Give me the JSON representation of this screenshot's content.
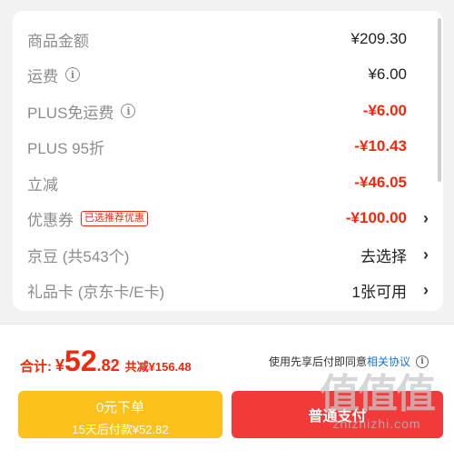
{
  "summary": {
    "rows": [
      {
        "label": "商品金额",
        "value": "¥209.30"
      },
      {
        "label": "运费",
        "value": "¥6.00"
      },
      {
        "label": "PLUS免运费",
        "value": "-¥6.00"
      },
      {
        "label": "PLUS 95折",
        "value": "-¥10.43"
      },
      {
        "label": "立减",
        "value": "-¥46.05"
      },
      {
        "label": "优惠券",
        "tag": "已选推荐优惠",
        "value": "-¥100.00"
      },
      {
        "label": "京豆 (共543个)",
        "value": "去选择"
      },
      {
        "label": "礼品卡 (京东卡/E卡)",
        "value": "1张可用"
      }
    ],
    "info_icon": "i",
    "chevron": "›"
  },
  "footer": {
    "total_label": "合计:",
    "total_currency": "¥",
    "total_int": "52",
    "total_dec": ".82",
    "saved_text": "共减¥156.48",
    "agreement_prefix": "使用先享后付即同意",
    "agreement_link": "相关协议",
    "pay_later": {
      "line1": "0元下单",
      "line2": "15天后付款¥52.82"
    },
    "pay_now": "普通支付"
  },
  "watermark": {
    "big": "值值值",
    "small": "zhizhizhi.com"
  },
  "colors": {
    "accent_red": "#f2270c",
    "pay_later_yellow": "#fcc11a",
    "pay_now_red": "#f23a3a",
    "link_blue": "#1a6fd6"
  }
}
